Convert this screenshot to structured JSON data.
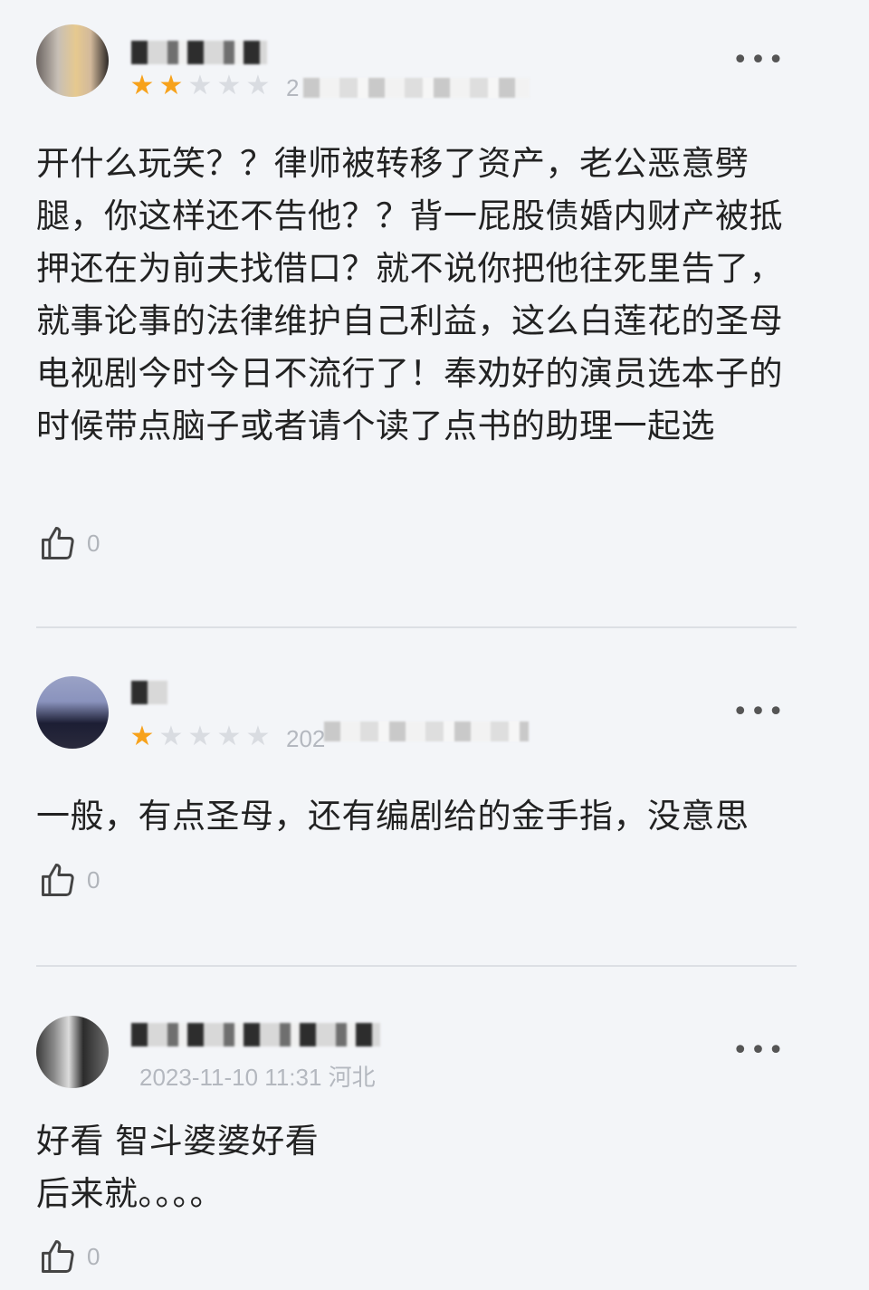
{
  "comments": [
    {
      "rating": 2,
      "meta_visible": "2",
      "text": "开什么玩笑？？律师被转移了资产，老公恶意劈腿，你这样还不告他？？背一屁股债婚内财产被抵押还在为前夫找借口？就不说你把他往死里告了，就事论事的法律维护自己利益，这么白莲花的圣母电视剧今时今日不流行了！奉劝好的演员选本子的时候带点脑子或者请个读了点书的助理一起选",
      "likes": "0",
      "more_label": "•••"
    },
    {
      "rating": 1,
      "meta_visible": "202",
      "text": "一般，有点圣母，还有编剧给的金手指，没意思",
      "likes": "0",
      "more_label": "•••"
    },
    {
      "rating": 0,
      "meta_visible": "2023-11-10 11:31 河北",
      "text": "好看 智斗婆婆好看\n后来就。。。。",
      "likes": "0",
      "more_label": "•••"
    }
  ],
  "colors": {
    "star_on": "#f7a21b",
    "star_off": "#d9dce1",
    "background": "#f3f5f8"
  },
  "icons": {
    "like": "thumbs-up-icon",
    "more": "more-dots-icon"
  }
}
